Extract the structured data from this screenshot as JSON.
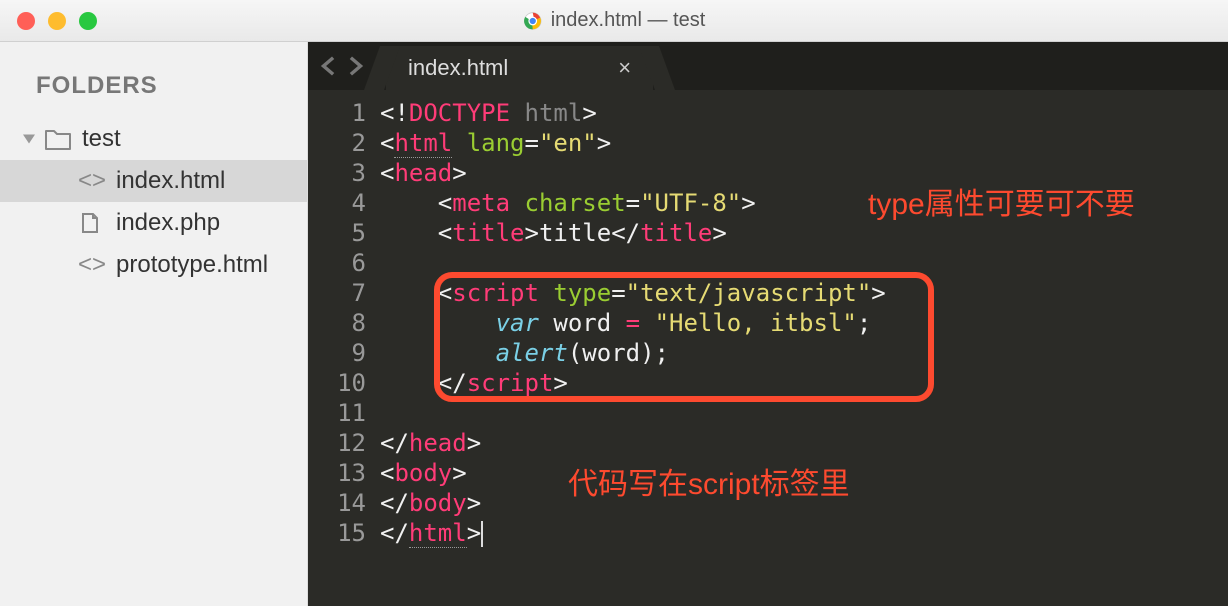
{
  "window": {
    "title": "index.html — test"
  },
  "sidebar": {
    "header": "FOLDERS",
    "root": {
      "name": "test",
      "expanded": true
    },
    "files": [
      {
        "name": "index.html",
        "kind": "html",
        "selected": true
      },
      {
        "name": "index.php",
        "kind": "php",
        "selected": false
      },
      {
        "name": "prototype.html",
        "kind": "html",
        "selected": false
      }
    ]
  },
  "tab": {
    "label": "index.html"
  },
  "gutter": {
    "lines": [
      "1",
      "2",
      "3",
      "4",
      "5",
      "6",
      "7",
      "8",
      "9",
      "10",
      "11",
      "12",
      "13",
      "14",
      "15"
    ]
  },
  "code": {
    "lines": [
      {
        "t": [
          {
            "c": "c-white",
            "s": "<!"
          },
          {
            "c": "c-pink",
            "s": "DOCTYPE"
          },
          {
            "c": "c-white",
            "s": " "
          },
          {
            "c": "c-gray",
            "s": "html"
          },
          {
            "c": "c-white",
            "s": ">"
          }
        ]
      },
      {
        "t": [
          {
            "c": "c-white",
            "s": "<"
          },
          {
            "c": "c-pink underline-dotted",
            "s": "html"
          },
          {
            "c": "c-white",
            "s": " "
          },
          {
            "c": "c-green",
            "s": "lang"
          },
          {
            "c": "c-white",
            "s": "="
          },
          {
            "c": "c-yellow",
            "s": "\"en\""
          },
          {
            "c": "c-white",
            "s": ">"
          }
        ]
      },
      {
        "t": [
          {
            "c": "c-white",
            "s": "<"
          },
          {
            "c": "c-pink",
            "s": "head"
          },
          {
            "c": "c-white",
            "s": ">"
          }
        ]
      },
      {
        "t": [
          {
            "c": "c-white",
            "s": "    <"
          },
          {
            "c": "c-pink",
            "s": "meta"
          },
          {
            "c": "c-white",
            "s": " "
          },
          {
            "c": "c-green",
            "s": "charset"
          },
          {
            "c": "c-white",
            "s": "="
          },
          {
            "c": "c-yellow",
            "s": "\"UTF-8\""
          },
          {
            "c": "c-white",
            "s": ">"
          }
        ]
      },
      {
        "t": [
          {
            "c": "c-white",
            "s": "    <"
          },
          {
            "c": "c-pink",
            "s": "title"
          },
          {
            "c": "c-white",
            "s": ">title</"
          },
          {
            "c": "c-pink",
            "s": "title"
          },
          {
            "c": "c-white",
            "s": ">"
          }
        ]
      },
      {
        "t": [
          {
            "c": "c-white",
            "s": ""
          }
        ]
      },
      {
        "t": [
          {
            "c": "c-white",
            "s": "    <"
          },
          {
            "c": "c-pink",
            "s": "script"
          },
          {
            "c": "c-white",
            "s": " "
          },
          {
            "c": "c-green",
            "s": "type"
          },
          {
            "c": "c-white",
            "s": "="
          },
          {
            "c": "c-yellow",
            "s": "\"text/javascript\""
          },
          {
            "c": "c-white",
            "s": ">"
          }
        ]
      },
      {
        "t": [
          {
            "c": "c-white",
            "s": "        "
          },
          {
            "c": "c-blue",
            "s": "var"
          },
          {
            "c": "c-white",
            "s": " word "
          },
          {
            "c": "c-pink",
            "s": "="
          },
          {
            "c": "c-white",
            "s": " "
          },
          {
            "c": "c-yellow",
            "s": "\"Hello, itbsl\""
          },
          {
            "c": "c-white",
            "s": ";"
          }
        ]
      },
      {
        "t": [
          {
            "c": "c-white",
            "s": "        "
          },
          {
            "c": "c-blue",
            "s": "alert"
          },
          {
            "c": "c-white",
            "s": "(word);"
          }
        ]
      },
      {
        "t": [
          {
            "c": "c-white",
            "s": "    </"
          },
          {
            "c": "c-pink",
            "s": "script"
          },
          {
            "c": "c-white",
            "s": ">"
          }
        ]
      },
      {
        "t": [
          {
            "c": "c-white",
            "s": ""
          }
        ]
      },
      {
        "t": [
          {
            "c": "c-white",
            "s": "</"
          },
          {
            "c": "c-pink",
            "s": "head"
          },
          {
            "c": "c-white",
            "s": ">"
          }
        ]
      },
      {
        "t": [
          {
            "c": "c-white",
            "s": "<"
          },
          {
            "c": "c-pink",
            "s": "body"
          },
          {
            "c": "c-white",
            "s": ">"
          }
        ]
      },
      {
        "t": [
          {
            "c": "c-white",
            "s": "</"
          },
          {
            "c": "c-pink",
            "s": "body"
          },
          {
            "c": "c-white",
            "s": ">"
          }
        ]
      },
      {
        "t": [
          {
            "c": "c-white",
            "s": "</"
          },
          {
            "c": "c-pink underline-dotted",
            "s": "html"
          },
          {
            "c": "c-white",
            "s": ">"
          }
        ],
        "cursor": true
      }
    ]
  },
  "annotations": {
    "text1": "type属性可要可不要",
    "text2": "代码写在script标签里"
  }
}
